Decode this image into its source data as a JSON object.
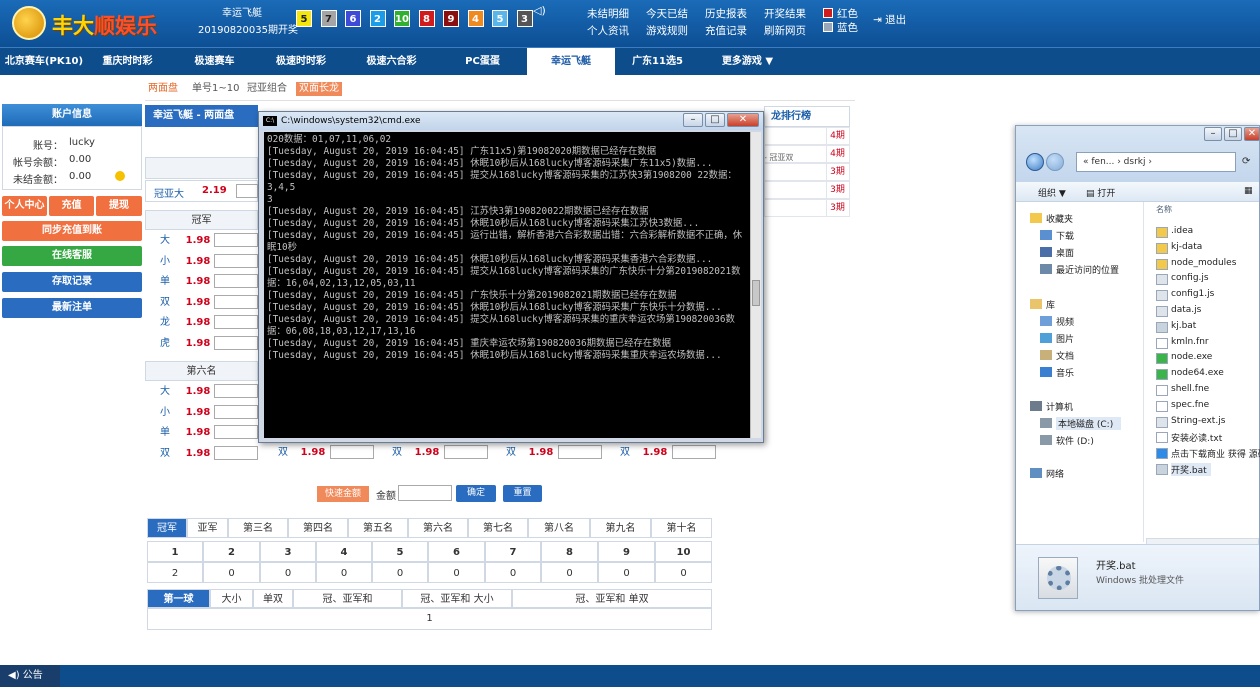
{
  "header": {
    "logo_text_a": "丰大",
    "logo_text_b": "顺娱乐",
    "game_name": "幸运飞艇",
    "issue_text": "20190820035期开奖",
    "balls": [
      {
        "num": "5",
        "color": "#f5e60d",
        "text_color": "#222"
      },
      {
        "num": "7",
        "color": "#a5a5a5",
        "text_color": "#222"
      },
      {
        "num": "6",
        "color": "#3e4bd6",
        "text_color": "#fff"
      },
      {
        "num": "2",
        "color": "#1a9ce8",
        "text_color": "#fff"
      },
      {
        "num": "10",
        "color": "#30b030",
        "text_color": "#fff"
      },
      {
        "num": "8",
        "color": "#d01c1c",
        "text_color": "#fff"
      },
      {
        "num": "9",
        "color": "#8a1010",
        "text_color": "#fff"
      },
      {
        "num": "4",
        "color": "#f08a1e",
        "text_color": "#fff"
      },
      {
        "num": "5",
        "color": "#5ab6e8",
        "text_color": "#fff"
      },
      {
        "num": "3",
        "color": "#555555",
        "text_color": "#fff"
      }
    ],
    "links": {
      "unsettled": "未结明细",
      "today_settled": "今天已结",
      "history": "历史报表",
      "draw_results": "开奖结果",
      "profile": "个人资讯",
      "rules": "游戏规则",
      "recharge_record": "充值记录",
      "refresh": "刷新网页",
      "red": "红色",
      "blue": "蓝色",
      "logout": "退出"
    }
  },
  "nav": [
    "北京赛车(PK10)",
    "重庆时时彩",
    "极速赛车",
    "极速时时彩",
    "极速六合彩",
    "PC蛋蛋",
    "幸运飞艇",
    "广东11选5",
    "更多游戏 ▼"
  ],
  "nav_active_index": 6,
  "subtabs": [
    "两面盘",
    "单号1~10",
    "冠亚组合",
    "双面长龙"
  ],
  "account": {
    "header": "账户信息",
    "account_label": "账号：",
    "account_value": "lucky",
    "balance_label": "帐号余额：",
    "balance_value": "0.00",
    "unsettled_label": "未结金额：",
    "unsettled_value": "0.00",
    "btn_center": "个人中心",
    "btn_recharge": "充值",
    "btn_withdraw": "提现",
    "btn_sync": "同步充值到账",
    "btn_online": "在线客服",
    "btn_records": "存取记录",
    "btn_latest": "最新注单"
  },
  "game": {
    "title": "幸运飞艇 - 两面盘",
    "champ_sum_label": "冠亚大",
    "champ_sum_odds": "2.19",
    "group1_title": "冠军",
    "group1_rows": [
      {
        "label": "大",
        "odds": "1.98"
      },
      {
        "label": "小",
        "odds": "1.98"
      },
      {
        "label": "单",
        "odds": "1.98"
      },
      {
        "label": "双",
        "odds": "1.98"
      },
      {
        "label": "龙",
        "odds": "1.98"
      },
      {
        "label": "虎",
        "odds": "1.98"
      }
    ],
    "group6_title": "第六名",
    "group6_rows": [
      {
        "label": "大",
        "odds": "1.98"
      },
      {
        "label": "小",
        "odds": "1.98"
      },
      {
        "label": "单",
        "odds": "1.98"
      },
      {
        "label": "双",
        "odds": "1.98"
      }
    ],
    "double_row": [
      {
        "label": "双",
        "odds": "1.98"
      },
      {
        "label": "双",
        "odds": "1.98"
      },
      {
        "label": "双",
        "odds": "1.98"
      },
      {
        "label": "双",
        "odds": "1.98"
      }
    ]
  },
  "leaderboard": {
    "title": "龙排行榜",
    "partial": "- 冠亚双",
    "values": [
      "4期",
      "4期",
      "3期",
      "3期",
      "3期"
    ]
  },
  "cmd": {
    "title": "C:\\windows\\system32\\cmd.exe",
    "lines": [
      "020数据：01,07,11,06,02",
      "[Tuesday, August 20, 2019 16:04:45] 广东11x5)第19082020期数据已经存在数据",
      "[Tuesday, August 20, 2019 16:04:45] 休眠10秒后从168lucky博客源码采集广东11x5)数据...",
      "[Tuesday, August 20, 2019 16:04:45] 提交从168lucky博客源码采集的江苏快3第1908200 22数据：3,4,5",
      "3",
      "[Tuesday, August 20, 2019 16:04:45] 江苏快3第190820022期数据已经存在数据",
      "[Tuesday, August 20, 2019 16:04:45] 休眠10秒后从168lucky博客源码采集江苏快3数据...",
      "[Tuesday, August 20, 2019 16:04:45] 运行出错，解析香港六合彩数据出错：六合彩解析数据不正确，休眠10秒",
      "[Tuesday, August 20, 2019 16:04:45] 休眠10秒后从168lucky博客源码采集香港六合彩数据...",
      "[Tuesday, August 20, 2019 16:04:45] 提交从168lucky博客源码采集的广东快乐十分第2019082021数据：16,04,02,13,12,05,03,11",
      "[Tuesday, August 20, 2019 16:04:45] 广东快乐十分第2019082021期数据已经存在数据",
      "[Tuesday, August 20, 2019 16:04:45] 休眠10秒后从168lucky博客源码采集广东快乐十分数据...",
      "[Tuesday, August 20, 2019 16:04:45] 提交从168lucky博客源码采集的重庆幸运农场第190820036数据：06,08,18,03,12,17,13,16",
      "[Tuesday, August 20, 2019 16:04:45] 重庆幸运农场第190820036期数据已经存在数据",
      "[Tuesday, August 20, 2019 16:04:45] 休眠10秒后从168lucky博客源码采集重庆幸运农场数据..."
    ]
  },
  "explorer": {
    "address": "« fen... › dsrkj ›",
    "toolbar": {
      "organize": "组织 ▼",
      "open": "打开"
    },
    "column": "名称",
    "tree": [
      "收藏夹",
      "下载",
      "桌面",
      "最近访问的位置",
      "库",
      "视频",
      "图片",
      "文档",
      "音乐",
      "计算机",
      "本地磁盘 (C:)",
      "软件 (D:)",
      "网络"
    ],
    "files": [
      ".idea",
      "kj-data",
      "node_modules",
      "config.js",
      "config1.js",
      "data.js",
      "kj.bat",
      "kmln.fnr",
      "node.exe",
      "node64.exe",
      "shell.fne",
      "spec.fne",
      "String-ext.js",
      "安装必读.txt",
      "点击下载商业 获得 源码",
      "开奖.bat"
    ],
    "details_name": "开奖.bat",
    "details_type": "Windows 批处理文件"
  },
  "bottom": {
    "quick_btn": "快速金额",
    "amount_label": "金额",
    "confirm": "确定",
    "reset": "重置",
    "rank_tabs": [
      "冠军",
      "亚军",
      "第三名",
      "第四名",
      "第五名",
      "第六名",
      "第七名",
      "第八名",
      "第九名",
      "第十名"
    ],
    "numbers": [
      "1",
      "2",
      "3",
      "4",
      "5",
      "6",
      "7",
      "8",
      "9",
      "10"
    ],
    "counts": [
      "2",
      "0",
      "0",
      "0",
      "0",
      "0",
      "0",
      "0",
      "0",
      "0"
    ],
    "stat_tabs": [
      "第一球",
      "大小",
      "单双",
      "冠、亚军和",
      "冠、亚军和 大小",
      "冠、亚军和 单双"
    ],
    "stat_value": "1"
  },
  "footer": {
    "announcement": "公告"
  }
}
